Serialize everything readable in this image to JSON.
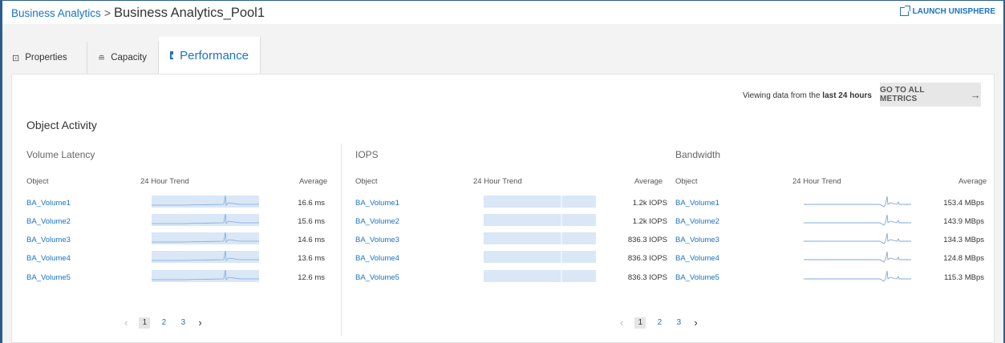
{
  "breadcrumb": {
    "parent": "Business Analytics",
    "separator": ">",
    "current": "Business Analytics_Pool1"
  },
  "launch_label": "LAUNCH UNISPHERE",
  "tabs": [
    {
      "label": "Properties",
      "icon": "properties-icon"
    },
    {
      "label": "Capacity",
      "icon": "capacity-icon"
    },
    {
      "label": "Performance",
      "icon": "performance-chart-icon"
    }
  ],
  "viewing": {
    "prefix": "Viewing data from the",
    "range": "last 24 hours"
  },
  "metrics_button": {
    "label": "GO TO ALL METRICS",
    "arrow": "→"
  },
  "object_activity_title": "Object Activity",
  "sections": {
    "latency": {
      "title": "Volume Latency",
      "headers": {
        "object": "Object",
        "trend": "24 Hour Trend",
        "average": "Average"
      },
      "rows": [
        {
          "object": "BA_Volume1",
          "average": "16.6 ms"
        },
        {
          "object": "BA_Volume2",
          "average": "15.6 ms"
        },
        {
          "object": "BA_Volume3",
          "average": "14.6 ms"
        },
        {
          "object": "BA_Volume4",
          "average": "13.6 ms"
        },
        {
          "object": "BA_Volume5",
          "average": "12.6 ms"
        }
      ]
    },
    "iops": {
      "title": "IOPS",
      "headers": {
        "object": "Object",
        "trend": "24 Hour Trend",
        "average": "Average"
      },
      "rows": [
        {
          "object": "BA_Volume1",
          "average": "1.2k IOPS"
        },
        {
          "object": "BA_Volume2",
          "average": "1.2k IOPS"
        },
        {
          "object": "BA_Volume3",
          "average": "836.3 IOPS"
        },
        {
          "object": "BA_Volume4",
          "average": "836.3 IOPS"
        },
        {
          "object": "BA_Volume5",
          "average": "836.3 IOPS"
        }
      ]
    },
    "bandwidth": {
      "title": "Bandwidth",
      "headers": {
        "object": "Object",
        "trend": "24 Hour Trend",
        "average": "Average"
      },
      "rows": [
        {
          "object": "BA_Volume1",
          "average": "153.4 MBps"
        },
        {
          "object": "BA_Volume2",
          "average": "143.9 MBps"
        },
        {
          "object": "BA_Volume3",
          "average": "134.3 MBps"
        },
        {
          "object": "BA_Volume4",
          "average": "124.8 MBps"
        },
        {
          "object": "BA_Volume5",
          "average": "115.3 MBps"
        }
      ]
    }
  },
  "pagination": {
    "prev": "‹",
    "pages": [
      "1",
      "2",
      "3"
    ],
    "current": "1",
    "next": "›"
  },
  "colors": {
    "link": "#1a73c6",
    "spark_fill": "#d9e7f7",
    "spark_line": "#7fa8d8",
    "frame": "#2c5d8f"
  }
}
